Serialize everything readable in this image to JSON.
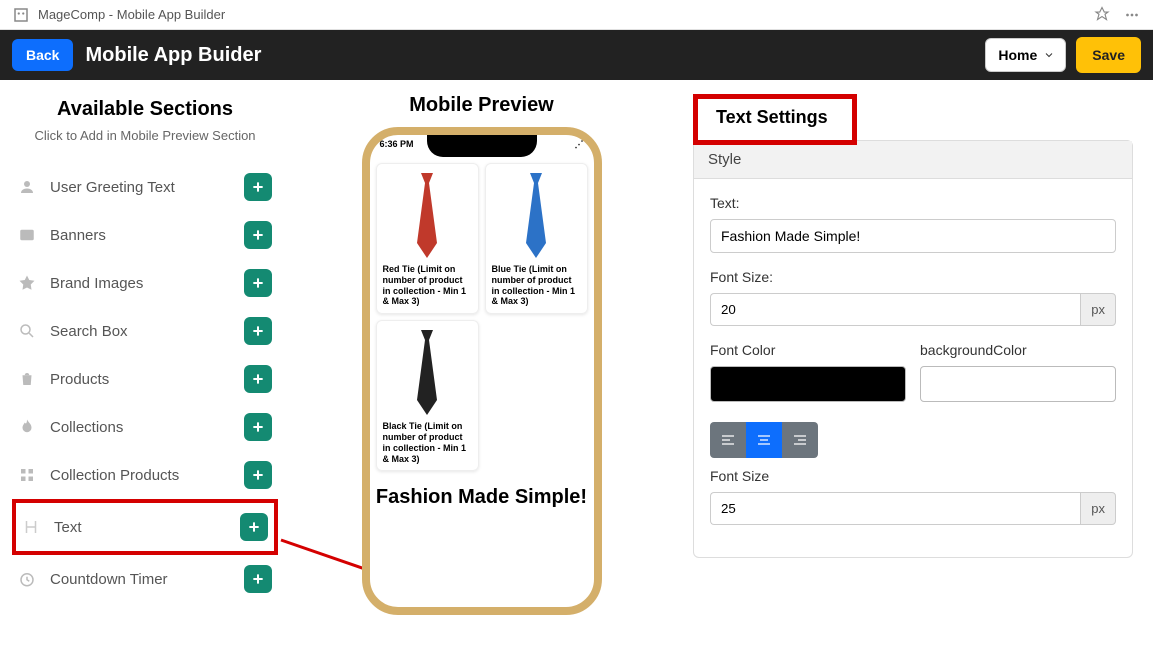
{
  "top_bar": {
    "title": "MageComp - Mobile App Builder"
  },
  "header": {
    "back_label": "Back",
    "app_title": "Mobile App Buider",
    "home_select": "Home",
    "save_label": "Save"
  },
  "sidebar": {
    "title": "Available Sections",
    "subtitle": "Click to Add in Mobile Preview Section",
    "items": [
      {
        "label": "User Greeting Text",
        "icon": "user"
      },
      {
        "label": "Banners",
        "icon": "image"
      },
      {
        "label": "Brand Images",
        "icon": "star"
      },
      {
        "label": "Search Box",
        "icon": "search"
      },
      {
        "label": "Products",
        "icon": "bag"
      },
      {
        "label": "Collections",
        "icon": "fire"
      },
      {
        "label": "Collection Products",
        "icon": "grid"
      },
      {
        "label": "Text",
        "icon": "heading"
      },
      {
        "label": "Countdown Timer",
        "icon": "clock"
      }
    ]
  },
  "preview": {
    "title": "Mobile Preview",
    "status_time": "6:36 PM",
    "products": [
      {
        "name": "Red Tie (Limit on number of product in collection - Min 1 & Max 3)",
        "color": "#c0392b"
      },
      {
        "name": "Blue Tie (Limit on number of product in collection - Min 1 & Max 3)",
        "color": "#2c72c7"
      },
      {
        "name": "Black Tie (Limit on number of product in collection - Min 1 & Max 3)",
        "color": "#222"
      }
    ],
    "text_block": "Fashion Made Simple!"
  },
  "settings": {
    "title": "Text Settings",
    "style_label": "Style",
    "text_label": "Text:",
    "text_value": "Fashion Made Simple!",
    "font_size_label": "Font Size:",
    "font_size_value": "20",
    "px_suffix": "px",
    "font_color_label": "Font Color",
    "font_color_value": "#000000",
    "bg_color_label": "backgroundColor",
    "bg_color_value": "#ffffff",
    "alignment": "center",
    "line_height_label": "Font Size",
    "line_height_value": "25"
  }
}
